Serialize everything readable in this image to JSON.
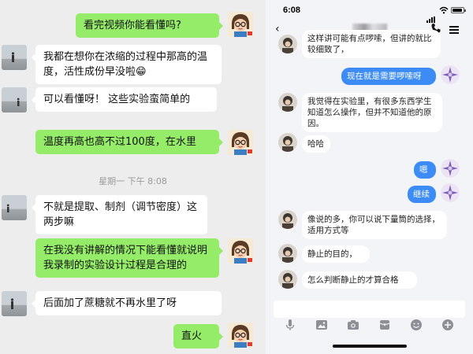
{
  "left_chat": {
    "messages": [
      {
        "side": "out",
        "text": "看完视频你能看懂吗?"
      },
      {
        "side": "in",
        "text": "我都在想你在浓缩的过程中那高的温度，活性成份早没啦😁"
      },
      {
        "side": "in",
        "text": "可以看懂呀！ 这些实验蛮简单的"
      },
      {
        "side": "out",
        "text": "温度再高也高不过100度，在水里"
      },
      {
        "side": "in",
        "text": "不就是提取、制剂（调节密度）这两步嘛"
      },
      {
        "side": "out",
        "text": "在我没有讲解的情况下能看懂就说明我录制的实验设计过程是合理的"
      },
      {
        "side": "in",
        "text": "后面加了蔗糖就不再水里了呀"
      },
      {
        "side": "out",
        "text": "直火"
      }
    ],
    "timestamp": "星期一 下午 8:08"
  },
  "phone": {
    "status_time": "6:08",
    "battery_level": 0.9,
    "contact_name": "",
    "messages": [
      {
        "side": "in",
        "text": "这样讲可能有点啰嗦，但讲的就比较细致了，"
      },
      {
        "side": "out",
        "text": "现在就是需要啰嗦呀"
      },
      {
        "side": "in",
        "text": "我觉得在实验里，有很多东西学生知道怎么操作，但并不知道他的原因。"
      },
      {
        "side": "in",
        "text": "哈哈"
      },
      {
        "side": "out",
        "text": "嗯"
      },
      {
        "side": "out",
        "text": "继续"
      },
      {
        "side": "in",
        "text": "像说的多，你可以说下量筒的选择，适用方式等"
      },
      {
        "side": "in",
        "text": "静止的目的，"
      },
      {
        "side": "in",
        "text": "怎么判断静止的才算合格"
      }
    ],
    "input_placeholder": "",
    "tool_icons": [
      "microphone-icon",
      "image-icon",
      "camera-icon",
      "red-packet-icon",
      "emoji-icon",
      "plus-icon"
    ]
  },
  "colors": {
    "wechat_bg": "#ededed",
    "wechat_out_bubble": "#95ec69",
    "phone_out_bubble": "#3d8cf5",
    "phone_bg": "#f3f4f8"
  }
}
